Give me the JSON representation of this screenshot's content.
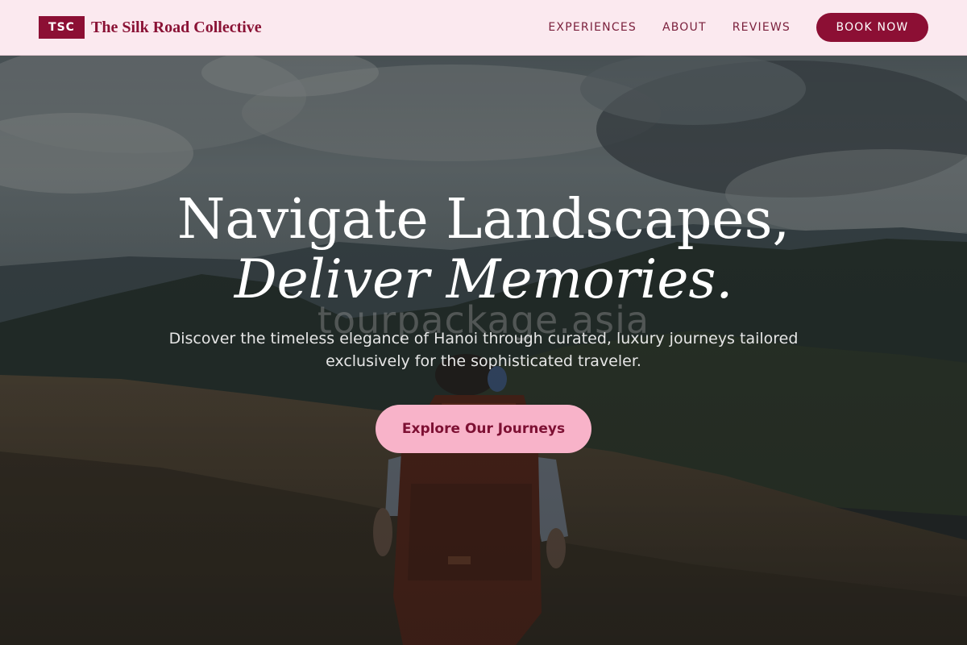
{
  "brand": {
    "badge": "TSC",
    "name": "The Silk Road Collective"
  },
  "nav": {
    "links": [
      "EXPERIENCES",
      "ABOUT",
      "REVIEWS"
    ],
    "cta_label": "BOOK NOW"
  },
  "hero": {
    "headline_line1": "Navigate Landscapes,",
    "headline_line2": "Deliver Memories.",
    "subtitle": "Discover the timeless elegance of Hanoi through curated, luxury journeys tailored exclusively for the sophisticated traveler.",
    "cta_label": "Explore Our Journeys",
    "watermark": "tourpackage.asia",
    "background_image": "hiker-with-orange-backpack-mountain-meadow"
  },
  "colors": {
    "brand": "#8c0f34",
    "nav_background": "#fbe9ef",
    "cta_background": "#f8b3c9",
    "cta_text": "#7d1033"
  }
}
